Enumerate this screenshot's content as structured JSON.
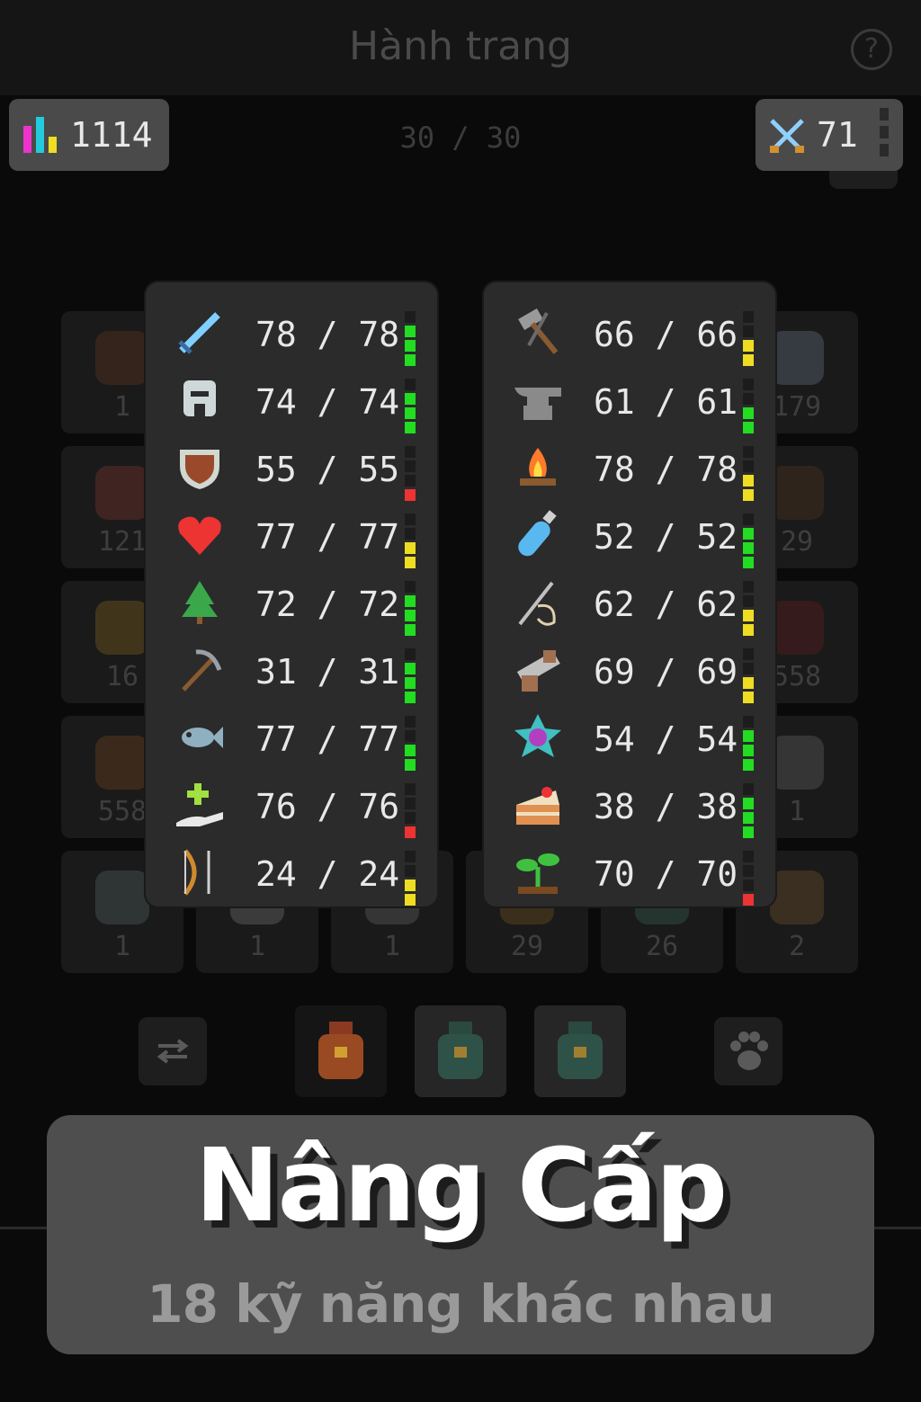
{
  "header": {
    "title": "Hành trang",
    "help_label": "?"
  },
  "total_level": {
    "icon": "bar-chart-icon",
    "value": "1114"
  },
  "inventory_capacity": "30 / 30",
  "combat_level": {
    "icon": "crossed-swords-icon",
    "value": "71"
  },
  "inventory": {
    "slots": [
      {
        "count": "1",
        "icon": "log-icon"
      },
      {
        "count": "179",
        "icon": "fish-icon"
      },
      {
        "count": "121",
        "icon": "raw-meat-icon"
      },
      {
        "count": "29",
        "icon": "boots-icon"
      },
      {
        "count": "16",
        "icon": "shield-icon"
      },
      {
        "count": "558",
        "icon": "pants-icon"
      },
      {
        "count": "558",
        "icon": "hide-icon"
      },
      {
        "count": "1",
        "icon": "chest-armor-icon"
      },
      {
        "count": "1",
        "icon": "helmet-icon"
      },
      {
        "count": "1",
        "icon": "gloves-icon"
      },
      {
        "count": "1",
        "icon": "dagger-icon"
      },
      {
        "count": "29",
        "icon": "ring-icon"
      },
      {
        "count": "26",
        "icon": "herb-icon"
      },
      {
        "count": "2",
        "icon": "plank-icon"
      }
    ]
  },
  "skills_left": [
    {
      "icon": "sword-icon",
      "text": "78 / 78",
      "color": "#7fd0ff",
      "bars": 3,
      "bar_color": "#22dd22"
    },
    {
      "icon": "helmet-icon",
      "text": "74 / 74",
      "color": "#cfd8d8",
      "bars": 3,
      "bar_color": "#22dd22"
    },
    {
      "icon": "shield-icon",
      "text": "55 / 55",
      "color": "#9a4a2a",
      "bars": 1,
      "bar_color": "#ee3333"
    },
    {
      "icon": "heart-icon",
      "text": "77 / 77",
      "color": "#ee3333",
      "bars": 2,
      "bar_color": "#eedd22"
    },
    {
      "icon": "tree-icon",
      "text": "72 / 72",
      "color": "#3aa84a",
      "bars": 3,
      "bar_color": "#22dd22"
    },
    {
      "icon": "pickaxe-icon",
      "text": "31 / 31",
      "color": "#b0603a",
      "bars": 3,
      "bar_color": "#22dd22"
    },
    {
      "icon": "fish-icon",
      "text": "77 / 77",
      "color": "#8fb0c0",
      "bars": 2,
      "bar_color": "#22dd22"
    },
    {
      "icon": "heal-hand-icon",
      "text": "76 / 76",
      "color": "#a0e040",
      "bars": 1,
      "bar_color": "#ee3333"
    },
    {
      "icon": "bow-icon",
      "text": "24 / 24",
      "color": "#d08a30",
      "bars": 2,
      "bar_color": "#eedd22"
    }
  ],
  "skills_right": [
    {
      "icon": "hammer-icon",
      "text": "66 / 66",
      "color": "#9a9a9a",
      "bars": 2,
      "bar_color": "#eedd22"
    },
    {
      "icon": "anvil-icon",
      "text": "61 / 61",
      "color": "#8a8a8a",
      "bars": 2,
      "bar_color": "#22dd22"
    },
    {
      "icon": "campfire-icon",
      "text": "78 / 78",
      "color": "#ff7a2a",
      "bars": 2,
      "bar_color": "#eedd22"
    },
    {
      "icon": "potion-icon",
      "text": "52 / 52",
      "color": "#5ab8f0",
      "bars": 3,
      "bar_color": "#22dd22"
    },
    {
      "icon": "needle-icon",
      "text": "62 / 62",
      "color": "#c0c0c0",
      "bars": 2,
      "bar_color": "#eedd22"
    },
    {
      "icon": "saw-icon",
      "text": "69 / 69",
      "color": "#a07050",
      "bars": 2,
      "bar_color": "#eedd22"
    },
    {
      "icon": "gem-icon",
      "text": "54 / 54",
      "color": "#b040c0",
      "bars": 3,
      "bar_color": "#22dd22"
    },
    {
      "icon": "cake-icon",
      "text": "38 / 38",
      "color": "#e09050",
      "bars": 3,
      "bar_color": "#22dd22"
    },
    {
      "icon": "sprout-icon",
      "text": "70 / 70",
      "color": "#40c040",
      "bars": 1,
      "bar_color": "#ee3333"
    }
  ],
  "bottom_bar": {
    "swap_icon": "swap-arrows-icon",
    "pet_icon": "paw-icon",
    "bags": [
      "bag-icon",
      "bag-icon",
      "bag-icon"
    ]
  },
  "promo": {
    "title": "Nâng Cấp",
    "subtitle": "18 kỹ năng khác nhau"
  }
}
